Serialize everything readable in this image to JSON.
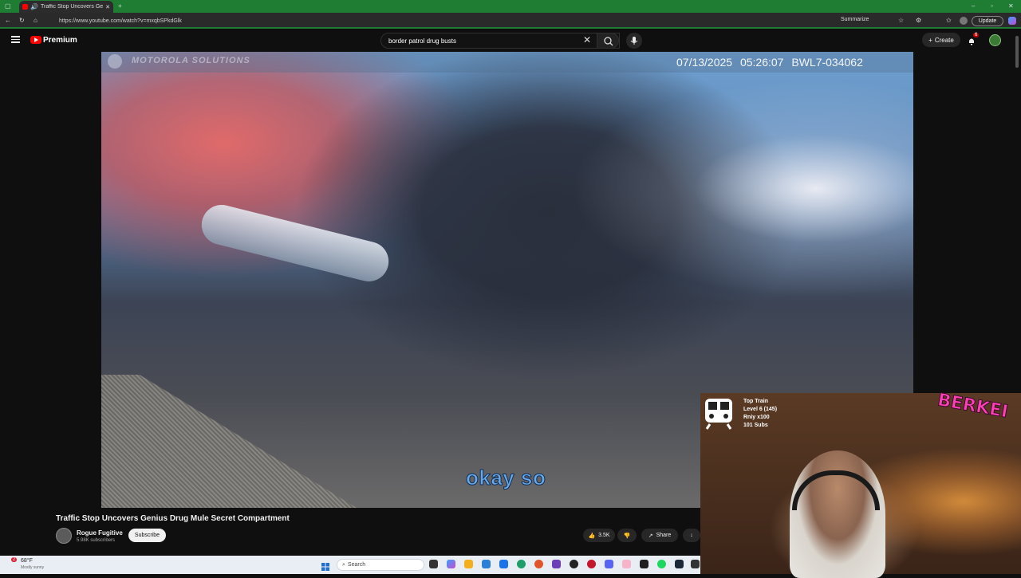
{
  "browser": {
    "tab_title": "Traffic Stop Uncovers Genius",
    "url": "https://www.youtube.com/watch?v=mxqbSPkdGlk",
    "summarize_label": "Summarize",
    "update_label": "Update"
  },
  "youtube": {
    "brand": "Premium",
    "search_query": "border patrol drug busts",
    "create_label": "Create",
    "notification_count": "6"
  },
  "video": {
    "overlay_brand": "MOTOROLA SOLUTIONS",
    "timestamp": "07/13/2025 05:26:07",
    "device_id": "BWL7-034062",
    "caption": "okay so",
    "title": "Traffic Stop Uncovers Genius Drug Mule Secret Compartment",
    "channel_name": "Rogue Fugitive",
    "channel_subs": "5.98K subscribers",
    "subscribe_label": "Subscribe",
    "like_count": "3.5K",
    "share_label": "Share"
  },
  "stream_overlay": {
    "train_title": "Top Train",
    "train_level": "Level 6  (145)",
    "train_mult": "Rniy x100",
    "train_subs": "101 Subs",
    "logo_text": "BERKEI"
  },
  "taskbar": {
    "weather_temp": "68°F",
    "weather_desc": "Mostly sunny",
    "weather_badge": "2",
    "search_placeholder": "Search"
  },
  "colors": {
    "browser_accent": "#1e7d32",
    "youtube_red": "#ff0000",
    "caption_blue": "#6aa9e8"
  }
}
